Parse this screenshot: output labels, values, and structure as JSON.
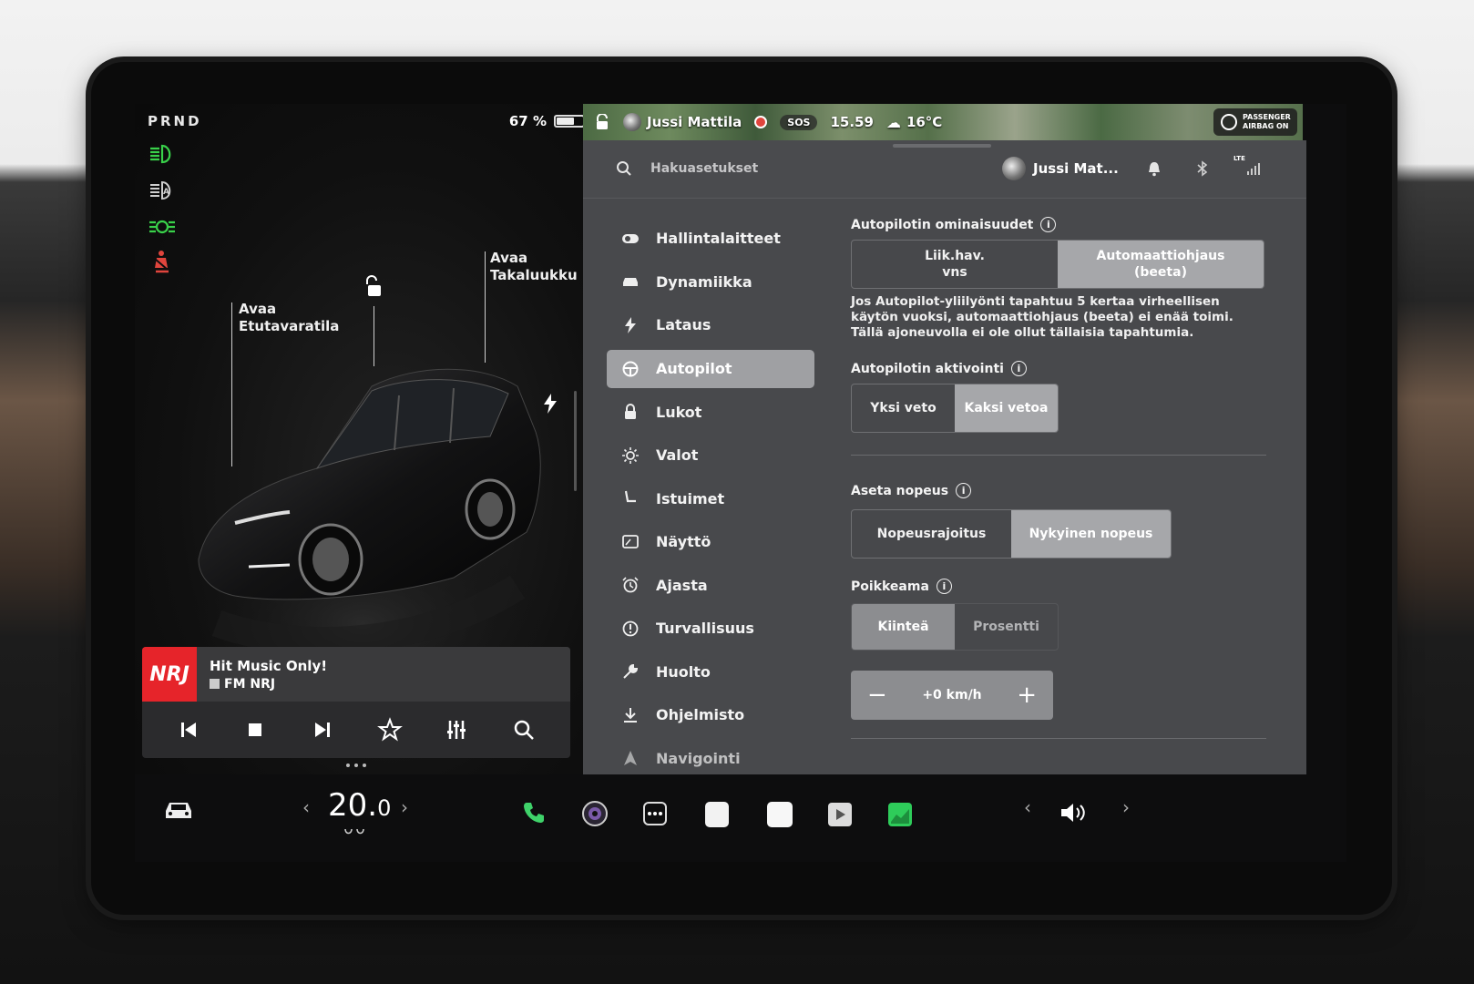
{
  "status": {
    "gear": "PRND",
    "battery_percent": "67 %",
    "battery_level": 0.67
  },
  "colors": {
    "telltale_green": "#39d14a",
    "seatbelt_red": "#e0453d",
    "active_menu": "#9fa0a3",
    "panel_bg": "#48494c",
    "nrj_red": "#e6242a"
  },
  "car": {
    "callout_front": "Avaa\nEtutavaratila",
    "callout_front_l1": "Avaa",
    "callout_front_l2": "Etutavaratila",
    "callout_rear_l1": "Avaa",
    "callout_rear_l2": "Takaluukku"
  },
  "media": {
    "title": "Hit Music Only!",
    "station": "FM NRJ",
    "logo": "NRJ"
  },
  "map_bar": {
    "driver": "Jussi Mattila",
    "sos": "SOS",
    "time": "15.59",
    "weather": "16°C",
    "airbag_l1": "PASSENGER",
    "airbag_l2": "AIRBAG ON"
  },
  "header": {
    "search_placeholder": "Hakuasetukset",
    "profile_name": "Jussi Mat...",
    "lte": "LTE"
  },
  "menu": {
    "items": [
      {
        "label": "Hallintalaitteet",
        "icon": "toggle-icon"
      },
      {
        "label": "Dynamiikka",
        "icon": "car-icon"
      },
      {
        "label": "Lataus",
        "icon": "bolt-icon"
      },
      {
        "label": "Autopilot",
        "icon": "steering-wheel-icon",
        "active": true
      },
      {
        "label": "Lukot",
        "icon": "lock-icon"
      },
      {
        "label": "Valot",
        "icon": "sun-icon"
      },
      {
        "label": "Istuimet",
        "icon": "seat-icon"
      },
      {
        "label": "Näyttö",
        "icon": "display-icon"
      },
      {
        "label": "Ajasta",
        "icon": "alarm-icon"
      },
      {
        "label": "Turvallisuus",
        "icon": "alert-icon"
      },
      {
        "label": "Huolto",
        "icon": "wrench-icon"
      },
      {
        "label": "Ohjelmisto",
        "icon": "download-icon"
      },
      {
        "label": "Navigointi",
        "icon": "navigation-icon"
      }
    ]
  },
  "autopilot": {
    "features_title": "Autopilotin ominaisuudet",
    "features_opt1_l1": "Liik.hav.",
    "features_opt1_l2": "vns",
    "features_opt2_l1": "Automaattiohjaus",
    "features_opt2_l2": "(beeta)",
    "features_note": "Jos Autopilot-yliilyönti tapahtuu 5 kertaa virheellisen käytön vuoksi, automaattiohjaus (beeta) ei enää toimi. Tällä ajoneuvolla ei ole ollut tällaisia tapahtumia.",
    "activation_title": "Autopilotin aktivointi",
    "activation_opt1": "Yksi veto",
    "activation_opt2": "Kaksi vetoa",
    "speed_title": "Aseta nopeus",
    "speed_opt1": "Nopeusrajoitus",
    "speed_opt2": "Nykyinen nopeus",
    "offset_title": "Poikkeama",
    "offset_opt1": "Kiinteä",
    "offset_opt2": "Prosentti",
    "offset_minus": "−",
    "offset_value": "+0 km/h",
    "offset_plus": "+",
    "info_glyph": "i"
  },
  "dock": {
    "temp_main": "20.",
    "temp_dec": "0",
    "chev_left": "‹",
    "chev_right": "›"
  }
}
